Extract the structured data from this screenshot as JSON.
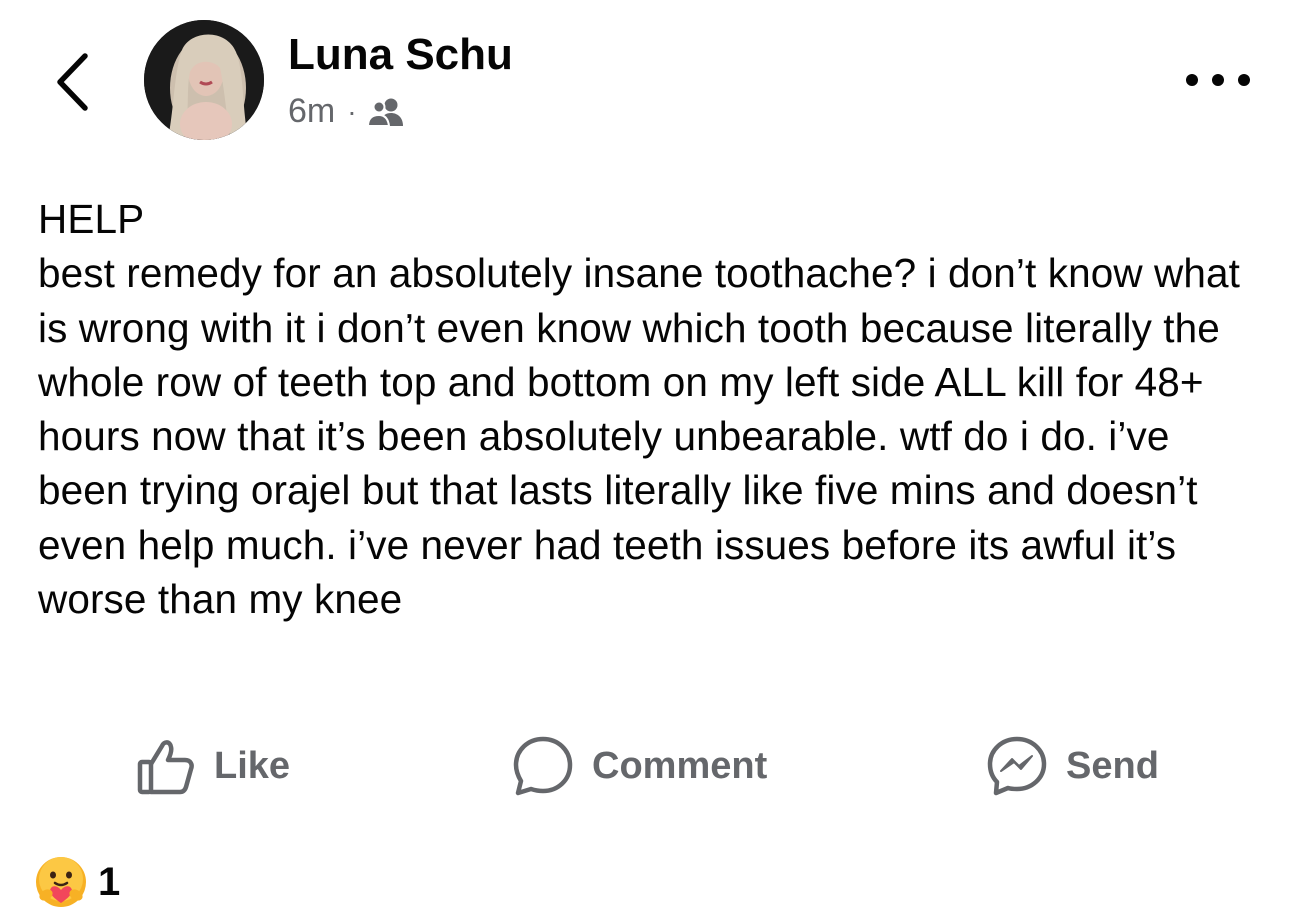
{
  "header": {
    "back_icon": "chevron-left-icon",
    "author_name": "Luna Schu",
    "timestamp": "6m",
    "separator": "·",
    "audience_icon": "friends-icon",
    "more_icon": "more-horizontal-icon"
  },
  "post": {
    "text": "HELP\nbest remedy for an absolutely insane toothache? i don’t know what is wrong with it i don’t even know which tooth because literally the whole row of teeth top and bottom on my left side ALL kill for 48+ hours now that it’s been absolutely unbearable. wtf do i do. i’ve been trying orajel but that lasts literally like five mins and doesn’t even help much. i’ve never had teeth issues before its awful it’s worse than my knee"
  },
  "actions": {
    "like_label": "Like",
    "comment_label": "Comment",
    "send_label": "Send"
  },
  "reactions": {
    "icon": "care-reaction-icon",
    "count": "1"
  },
  "colors": {
    "text": "#050505",
    "secondary": "#65676b",
    "background": "#ffffff"
  }
}
